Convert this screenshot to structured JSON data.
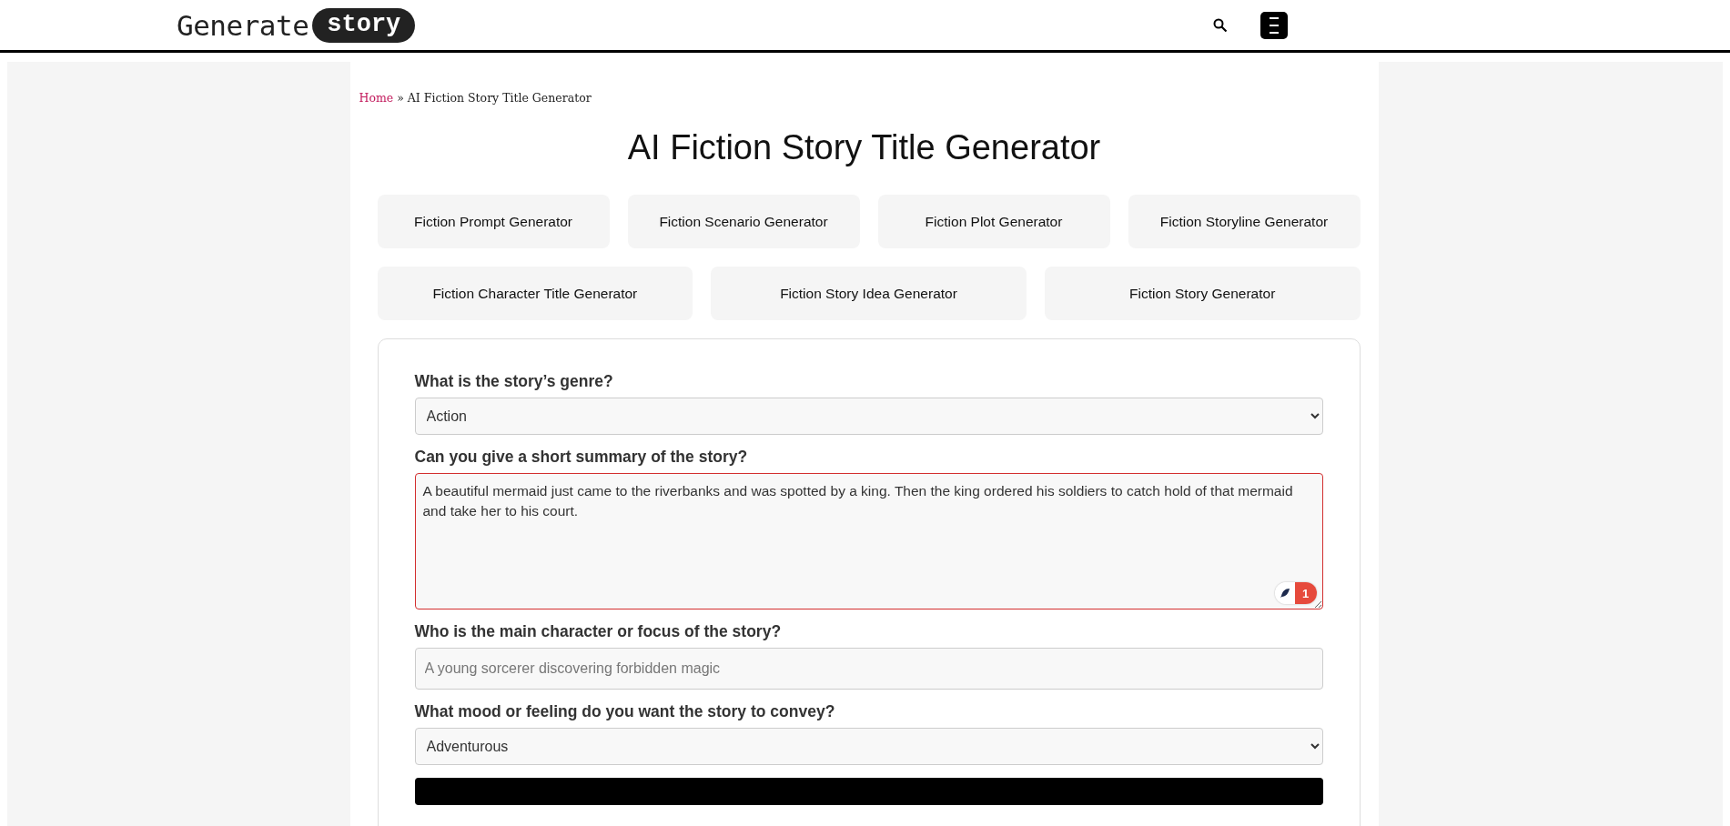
{
  "header": {
    "logo": {
      "word": "Generate",
      "badge": "story"
    }
  },
  "breadcrumb": {
    "home": "Home",
    "separator": "»",
    "current": "AI Fiction Story Title Generator"
  },
  "title": "AI Fiction Story Title Generator",
  "related_rows": [
    [
      "Fiction Prompt Generator",
      "Fiction Scenario Generator",
      "Fiction Plot Generator",
      "Fiction Storyline Generator"
    ],
    [
      "Fiction Character Title Generator",
      "Fiction Story Idea Generator",
      "Fiction Story Generator"
    ]
  ],
  "form": {
    "fields": [
      {
        "kind": "select",
        "label": "What is the story’s genre?",
        "value": "Action"
      },
      {
        "kind": "textarea",
        "label": "Can you give a short summary of the story?",
        "value": "A beautiful mermaid just came to the riverbanks and was spotted by a king. Then the king ordered his soldiers to catch hold of that mermaid and take her to his court.",
        "invalid": true,
        "assistant_count": "1"
      },
      {
        "kind": "text",
        "label": "Who is the main character or focus of the story?",
        "placeholder": "A young sorcerer discovering forbidden magic"
      },
      {
        "kind": "select",
        "label": "What mood or feeling do you want the story to convey?",
        "value": "Adventurous"
      }
    ]
  }
}
